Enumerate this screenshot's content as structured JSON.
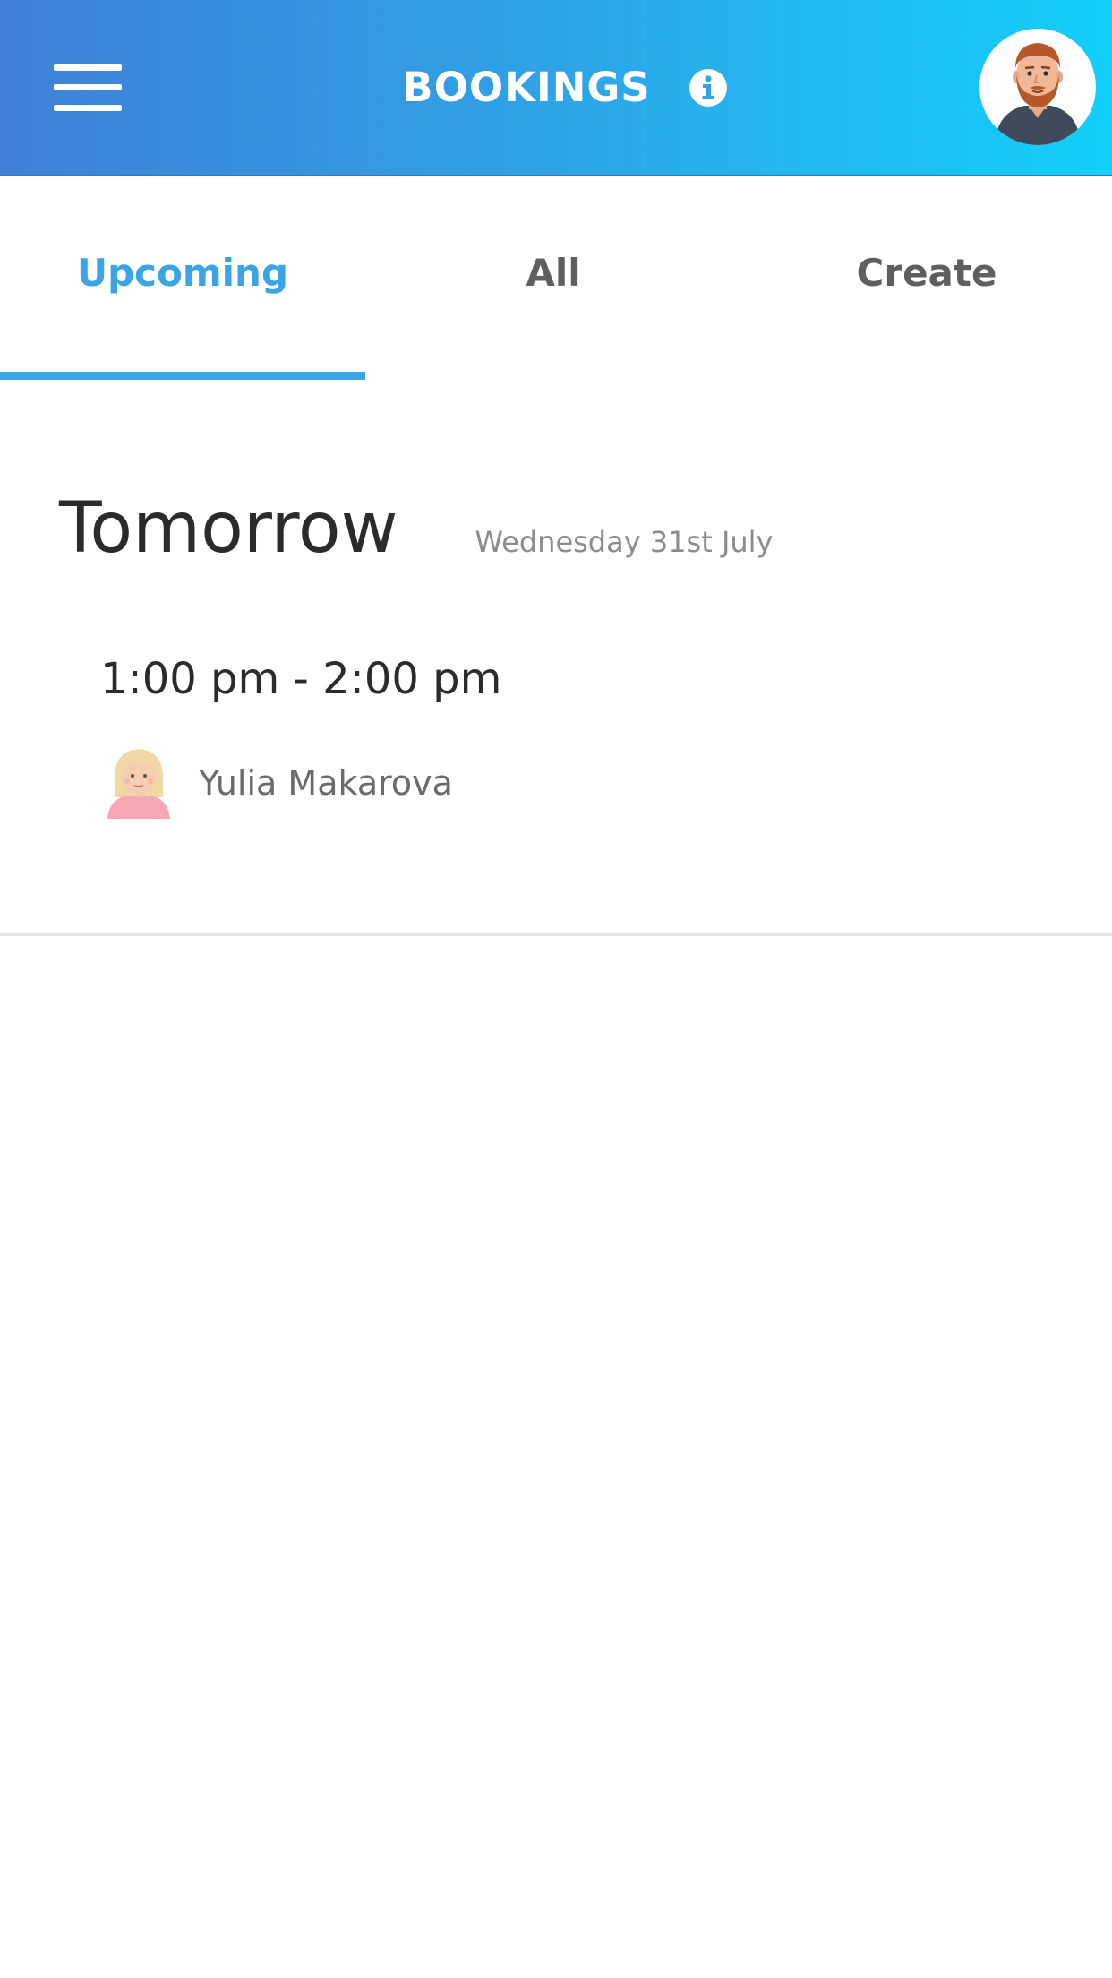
{
  "header": {
    "title": "BOOKINGS",
    "menu_icon": "hamburger-menu-icon",
    "info_icon": "info-icon",
    "avatar": "profile-avatar-bearded-man",
    "colors": {
      "gradient_start": "#3f7fd8",
      "gradient_end": "#12cffa"
    }
  },
  "tabs": [
    {
      "label": "Upcoming",
      "active": true
    },
    {
      "label": "All",
      "active": false
    },
    {
      "label": "Create",
      "active": false
    }
  ],
  "accent_color": "#3ba4e6",
  "day": {
    "title": "Tomorrow",
    "date": "Wednesday 31st July"
  },
  "booking": {
    "time": "1:00 pm - 2:00 pm",
    "attendee": "Yulia Makarova",
    "attendee_avatar": "blonde-woman-avatar"
  }
}
